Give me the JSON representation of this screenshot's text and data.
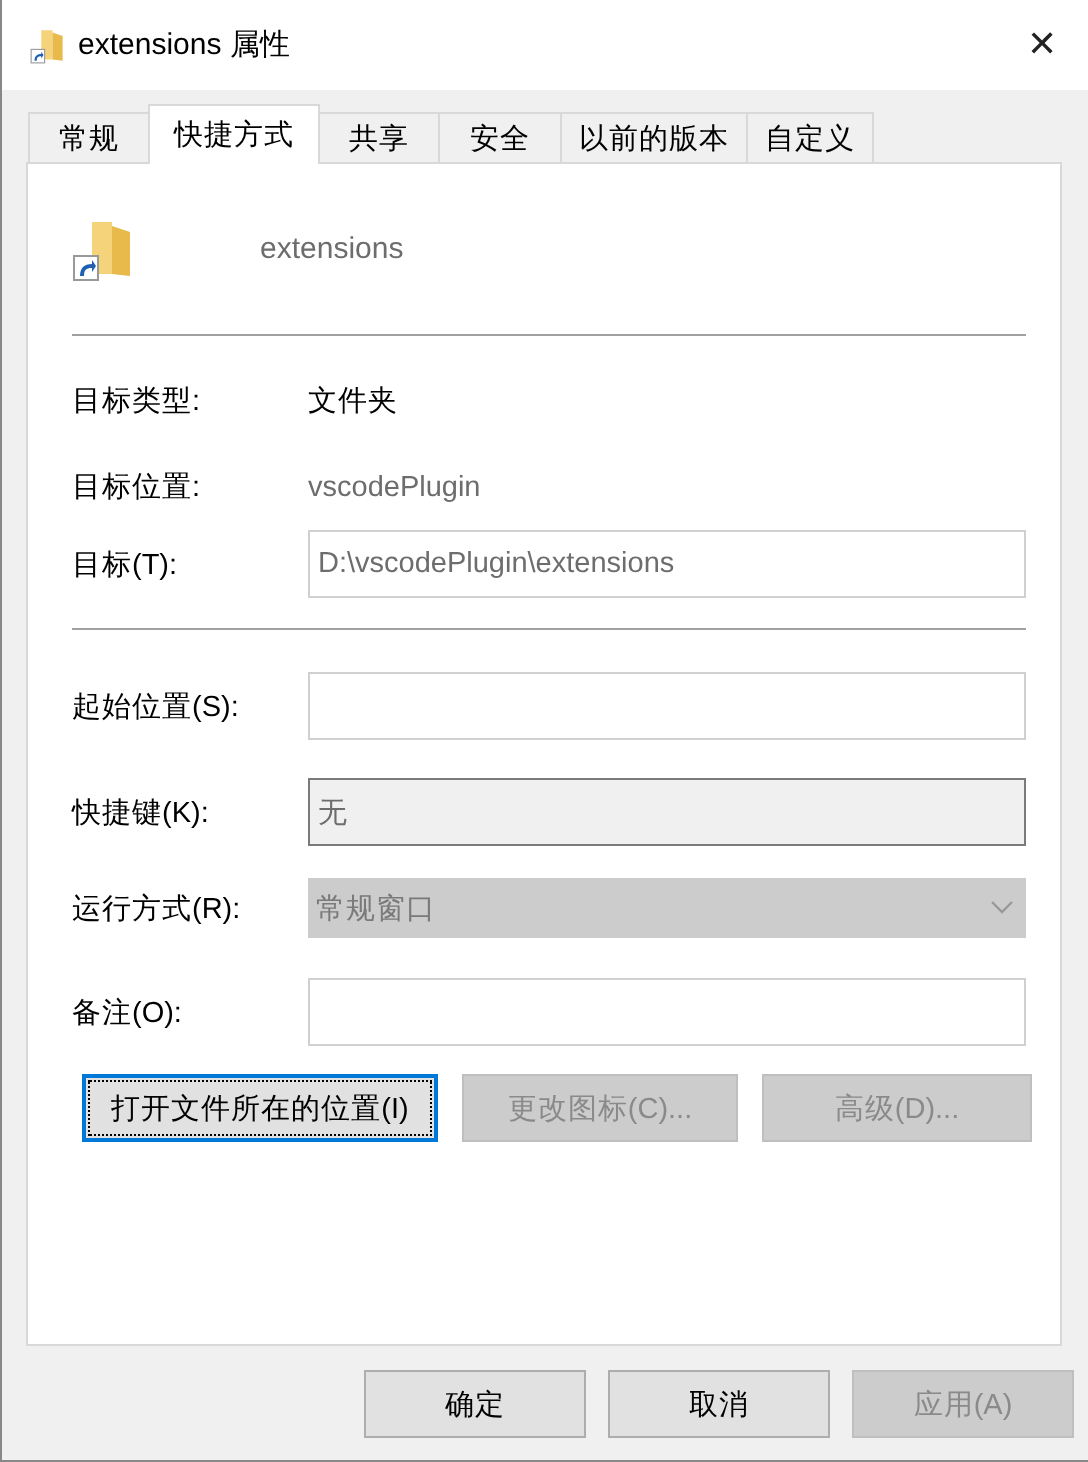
{
  "window": {
    "title": "extensions 属性",
    "close": "✕"
  },
  "tabs": [
    {
      "label": "常规",
      "selected": false
    },
    {
      "label": "快捷方式",
      "selected": true
    },
    {
      "label": "共享",
      "selected": false
    },
    {
      "label": "安全",
      "selected": false
    },
    {
      "label": "以前的版本",
      "selected": false
    },
    {
      "label": "自定义",
      "selected": false
    }
  ],
  "header": {
    "name": "extensions"
  },
  "info_rows": [
    {
      "label": "目标类型:",
      "value": "文件夹",
      "disabled": false
    },
    {
      "label": "目标位置:",
      "value": "vscodePlugin",
      "disabled": true
    }
  ],
  "target": {
    "label": "目标(T):",
    "value": "D:\\vscodePlugin\\extensions",
    "disabled": true
  },
  "fields": [
    {
      "kind": "input",
      "label": "起始位置(S):"
    },
    {
      "kind": "hotkey",
      "label": "快捷键(K):",
      "value": "无",
      "disabled": true
    },
    {
      "kind": "dropdown",
      "label": "运行方式(R):",
      "value": "常规窗口",
      "disabled": true
    },
    {
      "kind": "input",
      "label": "备注(O):"
    }
  ],
  "actions": [
    {
      "label": "打开文件所在的位置(I)",
      "disabled": false,
      "focused": true
    },
    {
      "label": "更改图标(C)...",
      "disabled": true,
      "focused": false
    },
    {
      "label": "高级(D)...",
      "disabled": true,
      "focused": false
    }
  ],
  "footer": [
    {
      "label": "确定",
      "disabled": false
    },
    {
      "label": "取消",
      "disabled": false
    },
    {
      "label": "应用(A)",
      "disabled": true
    }
  ]
}
